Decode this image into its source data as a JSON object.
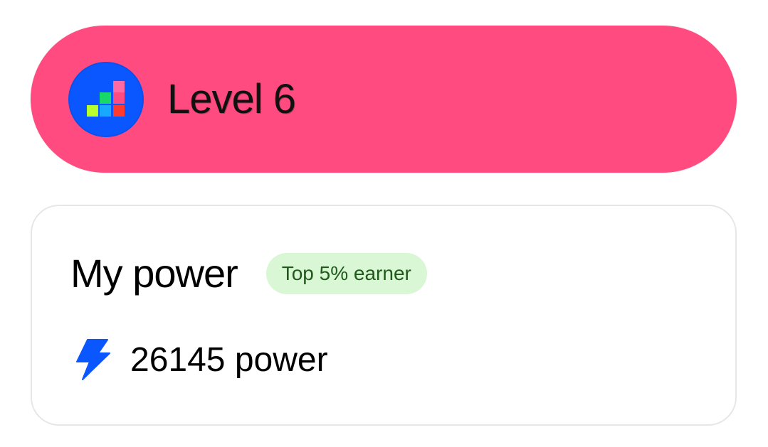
{
  "level_card": {
    "title": "Level 6",
    "badge_icon": "level-steps-icon",
    "background_color": "#ff4b7f",
    "badge_color": "#0b57ff"
  },
  "power_card": {
    "heading": "My power",
    "rank_badge": "Top 5% earner",
    "value_text": "26145 power",
    "value_icon": "lightning-bolt-icon",
    "accent_color": "#0b57ff",
    "badge_bg": "#d9f7d4",
    "badge_text_color": "#1f5a1a"
  }
}
